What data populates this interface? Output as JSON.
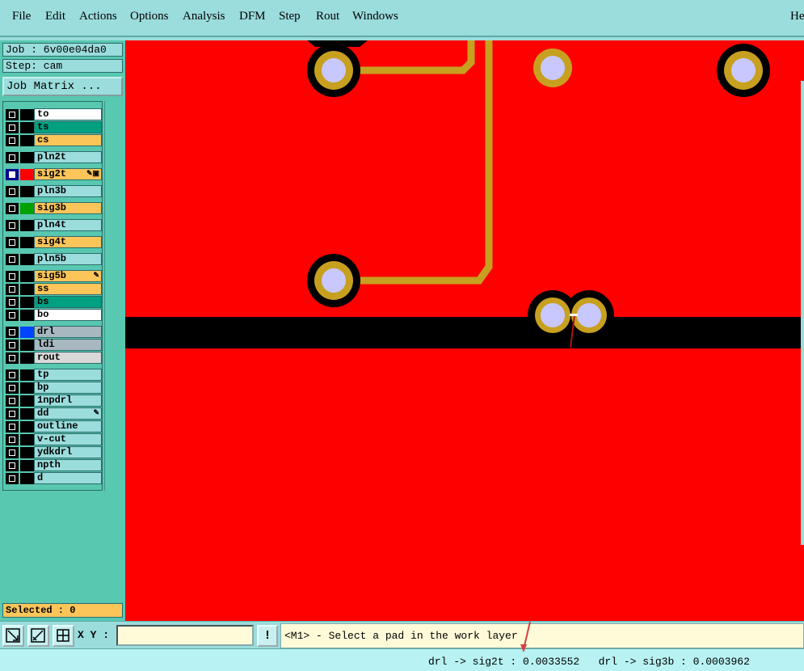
{
  "menu": {
    "items": [
      "File",
      "Edit",
      "Actions",
      "Options",
      "Analysis",
      "DFM",
      "Step",
      "Rout",
      "Windows"
    ],
    "help_label": "He"
  },
  "job": {
    "job_label": "Job : 6v00e04da0",
    "step_label": "Step: cam",
    "matrix_button": "Job Matrix ..."
  },
  "layers": [
    {
      "name": "to",
      "color": "#ffffff",
      "checked": false,
      "swatch": "#000000",
      "tag": ""
    },
    {
      "name": "ts",
      "color": "#00a080",
      "checked": false,
      "swatch": "#000000",
      "tag": ""
    },
    {
      "name": "cs",
      "color": "#fcc55a",
      "checked": false,
      "swatch": "#000000",
      "tag": ""
    },
    {
      "name": "pln2t",
      "color": "#9bdcdc",
      "checked": false,
      "swatch": "#000000",
      "tag": ""
    },
    {
      "name": "sig2t",
      "color": "#fcc55a",
      "checked": true,
      "swatch": "#ff0000",
      "tag": "✎▣"
    },
    {
      "name": "pln3b",
      "color": "#9bdcdc",
      "checked": false,
      "swatch": "#000000",
      "tag": ""
    },
    {
      "name": "sig3b",
      "color": "#fcc55a",
      "checked": false,
      "swatch": "#00a000",
      "tag": ""
    },
    {
      "name": "pln4t",
      "color": "#9bdcdc",
      "checked": false,
      "swatch": "#000000",
      "tag": ""
    },
    {
      "name": "sig4t",
      "color": "#fcc55a",
      "checked": false,
      "swatch": "#000000",
      "tag": ""
    },
    {
      "name": "pln5b",
      "color": "#9bdcdc",
      "checked": false,
      "swatch": "#000000",
      "tag": ""
    },
    {
      "name": "sig5b",
      "color": "#fcc55a",
      "checked": false,
      "swatch": "#000000",
      "tag": "✎"
    },
    {
      "name": "ss",
      "color": "#fcc55a",
      "checked": false,
      "swatch": "#000000",
      "tag": ""
    },
    {
      "name": "bs",
      "color": "#00a080",
      "checked": false,
      "swatch": "#000000",
      "tag": ""
    },
    {
      "name": "bo",
      "color": "#ffffff",
      "checked": false,
      "swatch": "#000000",
      "tag": ""
    },
    {
      "name": "drl",
      "color": "#a8b8c0",
      "checked": false,
      "swatch": "#0044ff",
      "tag": ""
    },
    {
      "name": "ldi",
      "color": "#a8b8c0",
      "checked": false,
      "swatch": "#000000",
      "tag": ""
    },
    {
      "name": "rout",
      "color": "#d8d8d8",
      "checked": false,
      "swatch": "#000000",
      "tag": ""
    },
    {
      "name": "tp",
      "color": "#9bdcdc",
      "checked": false,
      "swatch": "#000000",
      "tag": ""
    },
    {
      "name": "bp",
      "color": "#9bdcdc",
      "checked": false,
      "swatch": "#000000",
      "tag": ""
    },
    {
      "name": "1npdrl",
      "color": "#9bdcdc",
      "checked": false,
      "swatch": "#000000",
      "tag": ""
    },
    {
      "name": "dd",
      "color": "#9bdcdc",
      "checked": false,
      "swatch": "#000000",
      "tag": "✎"
    },
    {
      "name": "outline",
      "color": "#9bdcdc",
      "checked": false,
      "swatch": "#000000",
      "tag": ""
    },
    {
      "name": "v-cut",
      "color": "#9bdcdc",
      "checked": false,
      "swatch": "#000000",
      "tag": ""
    },
    {
      "name": "ydkdrl",
      "color": "#9bdcdc",
      "checked": false,
      "swatch": "#000000",
      "tag": ""
    },
    {
      "name": "npth",
      "color": "#9bdcdc",
      "checked": false,
      "swatch": "#000000",
      "tag": ""
    },
    {
      "name": "d",
      "color": "#9bdcdc",
      "checked": false,
      "swatch": "#000000",
      "tag": ""
    }
  ],
  "selected_label": "Selected : 0",
  "toolbar": {
    "xy_label": "X Y :",
    "xy_value": "",
    "excl_label": "!",
    "prompt": "<M1> - Select a pad in the work layer",
    "icons": [
      "resize-icon",
      "measure-icon",
      "grid-snap-icon"
    ]
  },
  "status": {
    "text": "drl -> sig2t : 0.0033552   drl -> sig3b : 0.0003962"
  },
  "colors": {
    "board": "#ff0000",
    "copper": "#c8a020",
    "hole": "#c8c8ff",
    "clearance": "#000000"
  }
}
